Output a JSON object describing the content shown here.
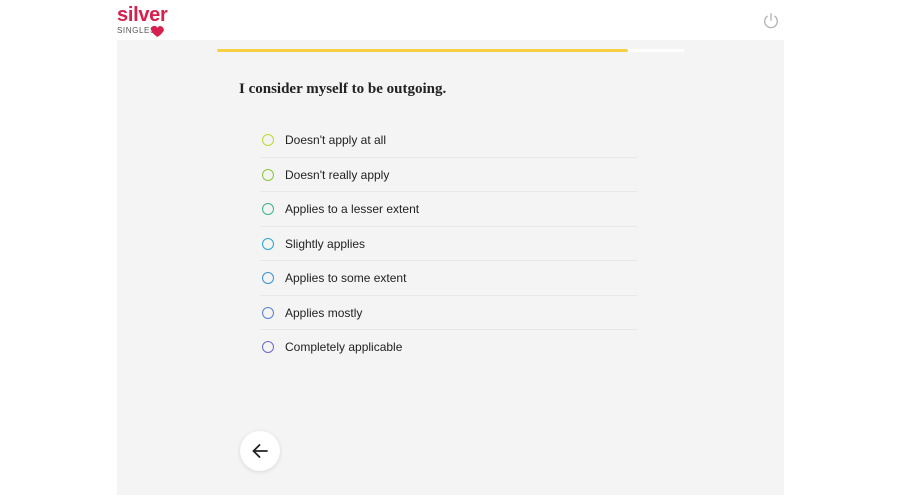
{
  "header": {
    "logo": {
      "word": "silver",
      "sub": "SINGLES",
      "brand_color": "#d6204e",
      "heart_icon": "heart-icon"
    },
    "power_icon": "power-icon"
  },
  "progress": {
    "fraction": 0.88,
    "fill_color": "#f7cf43"
  },
  "question": {
    "text": "I consider myself to be outgoing."
  },
  "options": [
    {
      "label": "Doesn't apply at all",
      "color": "#c3d630"
    },
    {
      "label": "Doesn't really apply",
      "color": "#8cc63f"
    },
    {
      "label": "Applies to a lesser extent",
      "color": "#3fb28c"
    },
    {
      "label": "Slightly applies",
      "color": "#2aa4cf"
    },
    {
      "label": "Applies to some extent",
      "color": "#3b92d8"
    },
    {
      "label": "Applies mostly",
      "color": "#5a7fd6"
    },
    {
      "label": "Completely applicable",
      "color": "#6e6ad2"
    }
  ],
  "navigation": {
    "back_icon": "arrow-left-icon"
  }
}
